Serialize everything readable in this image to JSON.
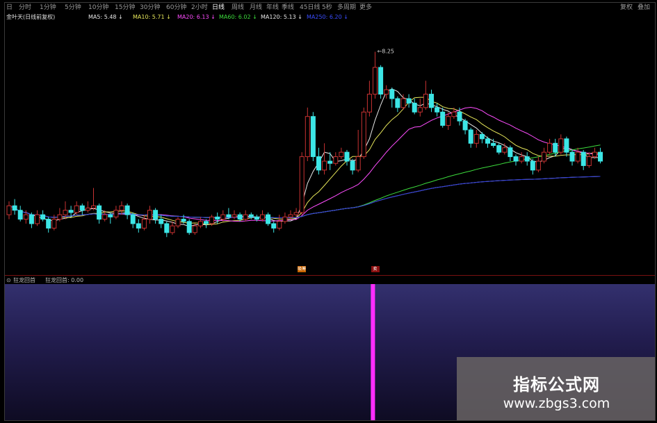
{
  "toolbar": {
    "items": [
      "日",
      "分时",
      "1分钟",
      "5分钟",
      "10分钟",
      "15分钟",
      "30分钟",
      "60分钟",
      "2小时",
      "日线",
      "周线",
      "月线",
      "年线",
      "季线",
      "45日线",
      "5秒",
      "多周期",
      "更多"
    ],
    "active": "日线",
    "right": [
      "复权",
      "叠加"
    ]
  },
  "legend": {
    "title": "金叶天(日线前复权)",
    "items": [
      {
        "label": "MA5: 5.48",
        "color": "#e8e8e8"
      },
      {
        "label": "MA10: 5.71",
        "color": "#e6e65a"
      },
      {
        "label": "MA20: 6.13",
        "color": "#ff4dff"
      },
      {
        "label": "MA60: 6.02",
        "color": "#3cdc3c"
      },
      {
        "label": "MA120: 5.13",
        "color": "#e8e8e8"
      },
      {
        "label": "MA250: 6.20",
        "color": "#3a4dff"
      }
    ]
  },
  "chart_data": {
    "type": "candlestick",
    "high_label": "8.25",
    "ylim": [
      3.7,
      8.6
    ],
    "colors": {
      "up": "#c83232",
      "down": "#3ce6e6"
    },
    "candles": [
      [
        4.6,
        4.8,
        4.9,
        4.5
      ],
      [
        4.8,
        4.7,
        4.95,
        4.6
      ],
      [
        4.7,
        4.5,
        4.8,
        4.45
      ],
      [
        4.5,
        4.6,
        4.7,
        4.4
      ],
      [
        4.6,
        4.4,
        4.65,
        4.3
      ],
      [
        4.4,
        4.6,
        4.7,
        4.35
      ],
      [
        4.6,
        4.5,
        4.7,
        4.45
      ],
      [
        4.5,
        4.3,
        4.55,
        4.2
      ],
      [
        4.3,
        4.5,
        4.6,
        4.25
      ],
      [
        4.5,
        4.6,
        4.75,
        4.45
      ],
      [
        4.6,
        4.7,
        4.9,
        4.5
      ],
      [
        4.7,
        4.65,
        4.8,
        4.55
      ],
      [
        4.65,
        4.8,
        4.9,
        4.6
      ],
      [
        4.8,
        4.7,
        4.85,
        4.6
      ],
      [
        4.7,
        4.75,
        4.9,
        4.65
      ],
      [
        4.75,
        4.8,
        5.2,
        4.7
      ],
      [
        4.8,
        4.5,
        4.85,
        4.4
      ],
      [
        4.5,
        4.6,
        4.7,
        4.45
      ],
      [
        4.6,
        4.55,
        4.65,
        4.4
      ],
      [
        4.55,
        4.7,
        4.8,
        4.5
      ],
      [
        4.7,
        4.8,
        4.9,
        4.6
      ],
      [
        4.8,
        4.6,
        4.85,
        4.5
      ],
      [
        4.6,
        4.4,
        4.65,
        4.3
      ],
      [
        4.4,
        4.3,
        4.5,
        4.2
      ],
      [
        4.3,
        4.5,
        4.6,
        4.25
      ],
      [
        4.5,
        4.7,
        4.8,
        4.4
      ],
      [
        4.7,
        4.5,
        4.75,
        4.4
      ],
      [
        4.5,
        4.4,
        4.6,
        4.3
      ],
      [
        4.4,
        4.2,
        4.45,
        4.1
      ],
      [
        4.2,
        4.35,
        4.45,
        4.15
      ],
      [
        4.35,
        4.5,
        4.55,
        4.3
      ],
      [
        4.5,
        4.45,
        4.6,
        4.4
      ],
      [
        4.45,
        4.2,
        4.5,
        4.15
      ],
      [
        4.2,
        4.35,
        4.4,
        4.15
      ],
      [
        4.35,
        4.45,
        4.55,
        4.3
      ],
      [
        4.45,
        4.4,
        4.5,
        4.3
      ],
      [
        4.4,
        4.55,
        4.6,
        4.35
      ],
      [
        4.55,
        4.5,
        4.65,
        4.4
      ],
      [
        4.5,
        4.6,
        4.7,
        4.45
      ],
      [
        4.6,
        4.55,
        4.75,
        4.5
      ],
      [
        4.55,
        4.6,
        4.7,
        4.5
      ],
      [
        4.6,
        4.5,
        4.65,
        4.45
      ],
      [
        4.5,
        4.6,
        4.7,
        4.45
      ],
      [
        4.6,
        4.55,
        4.65,
        4.5
      ],
      [
        4.55,
        4.5,
        4.6,
        4.45
      ],
      [
        4.5,
        4.6,
        4.7,
        4.45
      ],
      [
        4.6,
        4.4,
        4.65,
        4.35
      ],
      [
        4.4,
        4.3,
        4.45,
        4.2
      ],
      [
        4.3,
        4.45,
        4.6,
        4.25
      ],
      [
        4.45,
        4.55,
        4.65,
        4.4
      ],
      [
        4.55,
        4.6,
        4.7,
        4.5
      ],
      [
        4.6,
        4.65,
        4.75,
        4.55
      ],
      [
        4.65,
        5.9,
        6.0,
        4.6
      ],
      [
        5.9,
        6.8,
        7.0,
        5.8
      ],
      [
        6.8,
        5.9,
        6.9,
        5.8
      ],
      [
        5.9,
        5.6,
        6.1,
        5.5
      ],
      [
        5.6,
        5.8,
        6.2,
        5.5
      ],
      [
        5.8,
        5.75,
        6.0,
        5.6
      ],
      [
        5.75,
        5.9,
        6.0,
        5.7
      ],
      [
        5.9,
        6.0,
        6.1,
        5.85
      ],
      [
        6.0,
        5.8,
        6.05,
        5.7
      ],
      [
        5.8,
        5.6,
        5.85,
        5.5
      ],
      [
        5.6,
        5.9,
        6.5,
        5.55
      ],
      [
        5.9,
        6.9,
        7.0,
        5.85
      ],
      [
        6.9,
        7.3,
        7.6,
        6.8
      ],
      [
        7.3,
        7.9,
        8.25,
        7.2
      ],
      [
        7.9,
        7.3,
        7.95,
        7.2
      ],
      [
        7.3,
        7.4,
        7.5,
        7.2
      ],
      [
        7.4,
        7.2,
        7.45,
        7.0
      ],
      [
        7.2,
        7.0,
        7.25,
        6.9
      ],
      [
        7.0,
        7.2,
        7.3,
        6.95
      ],
      [
        7.2,
        7.1,
        7.3,
        7.0
      ],
      [
        7.1,
        6.9,
        7.2,
        6.85
      ],
      [
        6.9,
        7.0,
        7.2,
        6.8
      ],
      [
        7.0,
        7.3,
        7.6,
        6.95
      ],
      [
        7.3,
        7.0,
        7.4,
        6.9
      ],
      [
        7.0,
        6.9,
        7.1,
        6.8
      ],
      [
        6.9,
        6.6,
        7.0,
        6.55
      ],
      [
        6.6,
        6.8,
        6.9,
        6.5
      ],
      [
        6.8,
        6.9,
        7.0,
        6.75
      ],
      [
        6.9,
        6.7,
        7.0,
        6.6
      ],
      [
        6.7,
        6.5,
        6.75,
        6.4
      ],
      [
        6.5,
        6.2,
        6.55,
        6.1
      ],
      [
        6.2,
        6.4,
        6.5,
        6.1
      ],
      [
        6.4,
        6.3,
        6.45,
        6.2
      ],
      [
        6.3,
        6.2,
        6.35,
        6.1
      ],
      [
        6.2,
        6.15,
        6.3,
        6.1
      ],
      [
        6.15,
        6.0,
        6.2,
        5.95
      ],
      [
        6.0,
        6.1,
        6.2,
        5.95
      ],
      [
        6.1,
        5.9,
        6.15,
        5.8
      ],
      [
        5.9,
        5.8,
        5.95,
        5.7
      ],
      [
        5.8,
        5.9,
        6.0,
        5.75
      ],
      [
        5.9,
        5.8,
        6.0,
        5.7
      ],
      [
        5.8,
        5.6,
        5.85,
        5.5
      ],
      [
        5.6,
        5.8,
        5.9,
        5.55
      ],
      [
        5.8,
        6.0,
        6.1,
        5.75
      ],
      [
        6.0,
        6.2,
        6.3,
        5.95
      ],
      [
        6.2,
        6.0,
        6.3,
        5.9
      ],
      [
        6.0,
        6.3,
        6.4,
        5.95
      ],
      [
        6.3,
        6.0,
        6.35,
        5.9
      ],
      [
        6.0,
        5.8,
        6.05,
        5.7
      ],
      [
        5.8,
        6.0,
        6.1,
        5.75
      ],
      [
        6.0,
        5.7,
        6.05,
        5.6
      ],
      [
        5.7,
        5.9,
        6.0,
        5.65
      ],
      [
        5.9,
        6.0,
        6.1,
        5.85
      ],
      [
        6.0,
        5.8,
        6.1,
        5.75
      ]
    ],
    "signals": [
      {
        "index": 52,
        "label": "吸筹"
      },
      {
        "index": 65,
        "label": "卖"
      }
    ]
  },
  "indicator": {
    "name": "狂龙回首",
    "value_label": "狂龙回首: 0.00",
    "bar_index": 64,
    "bar_color": "#ff2dff"
  },
  "watermark": {
    "title": "指标公式网",
    "url": "www.zbgs3.com"
  }
}
